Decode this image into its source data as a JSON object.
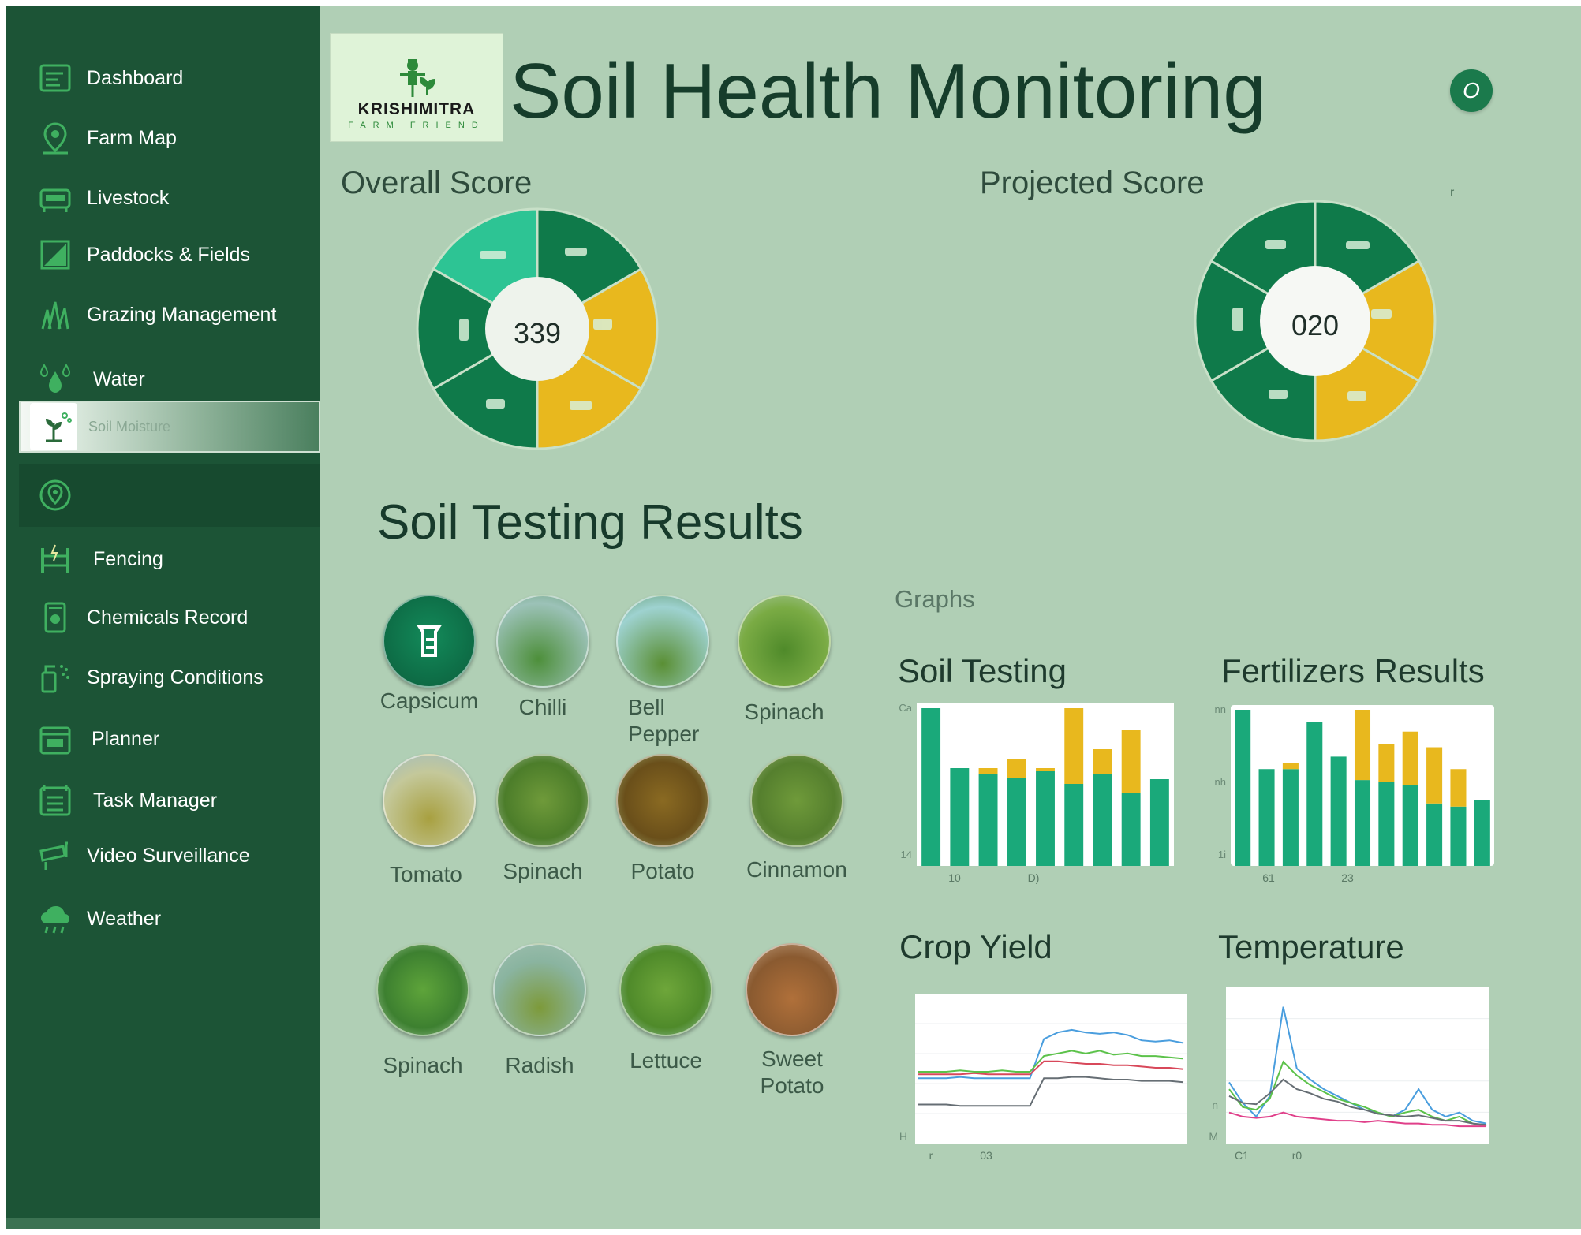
{
  "sidebar": {
    "items": [
      {
        "label": "Dashboard",
        "icon": "dashboard-icon"
      },
      {
        "label": "Farm Map",
        "icon": "map-pin-icon"
      },
      {
        "label": "Livestock",
        "icon": "livestock-icon"
      },
      {
        "label": "Paddocks & Fields",
        "icon": "field-icon"
      },
      {
        "label": "Grazing Management",
        "icon": "grass-icon"
      },
      {
        "label": "Water",
        "icon": "water-drops-icon"
      },
      {
        "label": "Soil Moisture",
        "icon": "plant-icon",
        "active": true
      },
      {
        "label": "",
        "icon": "location-target-icon"
      },
      {
        "label": "Fencing",
        "icon": "fence-icon"
      },
      {
        "label": "Chemicals Record",
        "icon": "chemical-icon"
      },
      {
        "label": "Spraying Conditions",
        "icon": "spray-icon"
      },
      {
        "label": "Planner",
        "icon": "planner-icon"
      },
      {
        "label": "Task Manager",
        "icon": "task-list-icon"
      },
      {
        "label": "Video Surveillance",
        "icon": "camera-icon"
      },
      {
        "label": "Weather",
        "icon": "cloud-rain-icon"
      }
    ]
  },
  "logo": {
    "brand": "KRISHIMITRA",
    "tagline": "FARM FRIEND"
  },
  "header": {
    "title": "Soil Health Monitoring",
    "help_glyph": "O"
  },
  "stray_mark": "r",
  "overall": {
    "label": "Overall Score",
    "value": "339"
  },
  "projected": {
    "label": "Projected Score",
    "value": "020"
  },
  "soil_results": {
    "title": "Soil Testing Results",
    "crops": [
      "Capsicum",
      "Chilli",
      "Bell Pepper",
      "Spinach",
      "Tomato",
      "Spinach",
      "Potato",
      "Cinnamon",
      "Spinach",
      "Radish",
      "Lettuce",
      "Sweet Potato"
    ]
  },
  "graphs": {
    "label": "Graphs",
    "soil_testing": {
      "title": "Soil Testing"
    },
    "fertilizers": {
      "title": "Fertilizers Results"
    },
    "crop_yield": {
      "title": "Crop Yield"
    },
    "temperature": {
      "title": "Temperature"
    }
  },
  "colors": {
    "sidebar": "#1c5436",
    "background": "#b0cfb5",
    "dark_green": "#0f7a4a",
    "teal": "#1aa97a",
    "yellow": "#e8b81e"
  },
  "chart_data": [
    {
      "type": "bar",
      "title": "Soil Testing",
      "series": [
        {
          "values": [
            100,
            62,
            58,
            56,
            60,
            52,
            58,
            46,
            55
          ]
        },
        {
          "values": [
            0,
            0,
            4,
            12,
            2,
            48,
            16,
            40,
            0
          ]
        }
      ],
      "ytick_labels": [
        "Ca",
        "14"
      ],
      "xtick_labels": [
        "10",
        "D)"
      ]
    },
    {
      "type": "bar",
      "title": "Fertilizers Results",
      "series": [
        {
          "values": [
            100,
            62,
            62,
            92,
            70,
            55,
            54,
            52,
            40,
            38,
            42
          ]
        },
        {
          "values": [
            0,
            0,
            4,
            0,
            0,
            45,
            24,
            34,
            36,
            24,
            0
          ]
        }
      ],
      "ytick_labels": [
        "nn",
        "nh",
        "1i"
      ],
      "xtick_labels": [
        "61",
        "23"
      ]
    },
    {
      "type": "line",
      "title": "Crop Yield",
      "x": [
        0,
        1,
        2,
        3,
        4,
        5,
        6,
        7,
        8,
        9,
        10,
        11,
        12,
        13,
        14,
        15,
        16,
        17,
        18,
        19
      ],
      "series": [
        {
          "values": [
            45,
            45,
            45,
            46,
            45,
            45,
            45,
            45,
            45,
            75,
            80,
            82,
            80,
            79,
            80,
            78,
            74,
            73,
            74,
            72
          ]
        },
        {
          "values": [
            50,
            50,
            50,
            51,
            50,
            50,
            51,
            50,
            50,
            62,
            64,
            66,
            64,
            66,
            63,
            64,
            62,
            62,
            61,
            60
          ]
        },
        {
          "values": [
            48,
            48,
            48,
            48,
            49,
            48,
            48,
            48,
            48,
            58,
            58,
            57,
            56,
            56,
            55,
            55,
            54,
            53,
            53,
            52
          ]
        },
        {
          "values": [
            25,
            25,
            25,
            24,
            24,
            24,
            24,
            24,
            24,
            45,
            45,
            46,
            46,
            45,
            44,
            44,
            43,
            43,
            43,
            42
          ]
        }
      ],
      "ytick_labels": [
        "H"
      ],
      "xtick_labels": [
        "r",
        "03"
      ]
    },
    {
      "type": "line",
      "title": "Temperature",
      "x": [
        0,
        1,
        2,
        3,
        4,
        5,
        6,
        7,
        8,
        9,
        10,
        11,
        12,
        13,
        14,
        15,
        16,
        17,
        18,
        19
      ],
      "series": [
        {
          "values": [
            40,
            25,
            15,
            30,
            95,
            50,
            42,
            35,
            30,
            25,
            20,
            18,
            15,
            20,
            35,
            20,
            15,
            18,
            12,
            10
          ]
        },
        {
          "values": [
            35,
            22,
            20,
            28,
            55,
            45,
            38,
            33,
            28,
            25,
            22,
            18,
            15,
            18,
            20,
            15,
            12,
            15,
            10,
            8
          ]
        },
        {
          "values": [
            30,
            25,
            24,
            32,
            42,
            35,
            32,
            28,
            26,
            22,
            20,
            17,
            16,
            15,
            16,
            14,
            12,
            12,
            10,
            9
          ]
        },
        {
          "values": [
            18,
            15,
            14,
            15,
            18,
            15,
            14,
            13,
            12,
            12,
            11,
            12,
            11,
            10,
            10,
            9,
            9,
            8,
            8,
            8
          ]
        }
      ],
      "ytick_labels": [
        "M",
        "n"
      ],
      "xtick_labels": [
        "C1",
        "r0"
      ]
    }
  ]
}
